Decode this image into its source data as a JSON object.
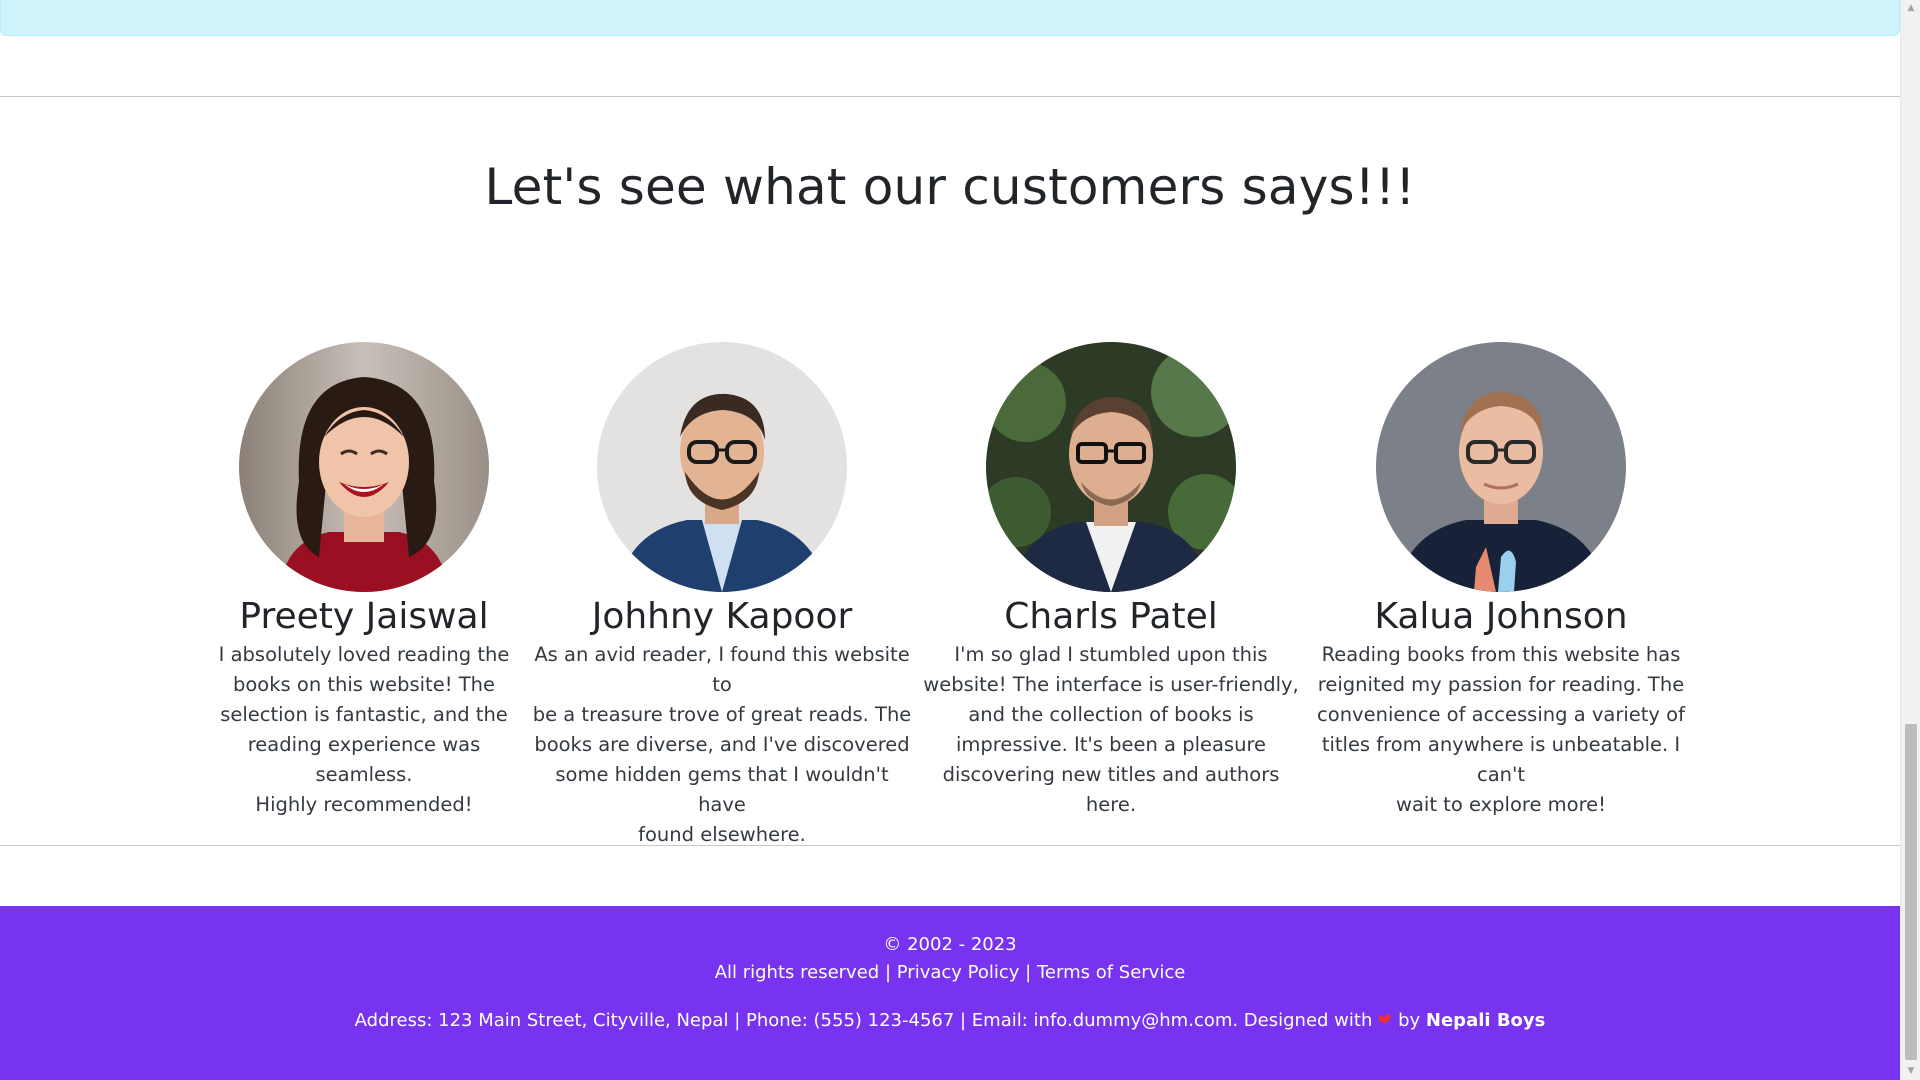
{
  "testimonials": {
    "heading": "Let's see what our customers says!!!",
    "cards": [
      {
        "name": "Preety Jaiswal",
        "lines": [
          "I absolutely loved reading the",
          "books on this website! The",
          "selection is fantastic, and the",
          "reading experience was seamless.",
          "Highly recommended!"
        ]
      },
      {
        "name": "Johhny Kapoor",
        "lines": [
          "As an avid reader, I found this website to",
          "be a treasure trove of great reads. The",
          "books are diverse, and I've discovered",
          "some hidden gems that I wouldn't have",
          "found elsewhere."
        ]
      },
      {
        "name": "Charls Patel",
        "lines": [
          "I'm so glad I stumbled upon this",
          "website! The interface is user-friendly,",
          "and the collection of books is",
          "impressive. It's been a pleasure",
          "discovering new titles and authors here."
        ]
      },
      {
        "name": "Kalua Johnson",
        "lines": [
          "Reading books from this website has",
          "reignited my passion for reading. The",
          "convenience of accessing a variety of",
          "titles from anywhere is unbeatable. I can't",
          "wait to explore more!"
        ]
      }
    ]
  },
  "footer": {
    "copyright": "© 2002 - 2023",
    "rights": "All rights reserved",
    "sep": "|",
    "privacy": "Privacy Policy",
    "terms": "Terms of Service",
    "contact": "Address: 123 Main Street, Cityville, Nepal | Phone: (555) 123-4567 | Email: info.dummy@hm.com. Designed with",
    "by": "by",
    "brand": "Nepali Boys",
    "heart_icon": "heart-icon",
    "bg_color": "#7733f0"
  },
  "scrollbar": {
    "up_icon": "scroll-up-arrow-icon",
    "down_icon": "scroll-down-arrow-icon"
  }
}
